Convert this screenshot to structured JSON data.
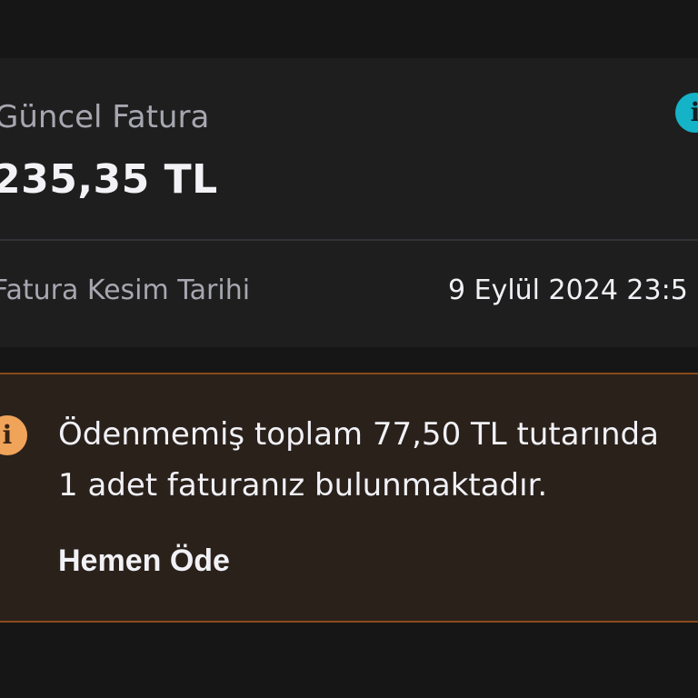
{
  "invoice": {
    "current_label": "Güncel Fatura",
    "current_amount": "235,35 TL",
    "issue_date_label": "Fatura Kesim Tarihi",
    "issue_date_value": "9 Eylül 2024 23:5",
    "info_icon": "info-icon"
  },
  "warning": {
    "icon": "info-icon",
    "message_lines": [
      "Ödenmemiş toplam 77,50 TL tutarında",
      "1 adet faturanız bulunmaktadır."
    ],
    "action_label": "Hemen Öde"
  },
  "colors": {
    "background": "#161616",
    "card": "#1e1e1e",
    "info_accent": "#14b3c8",
    "warning_background": "#2a211b",
    "warning_border": "#8a4a1c",
    "warning_accent": "#f0a45a"
  }
}
